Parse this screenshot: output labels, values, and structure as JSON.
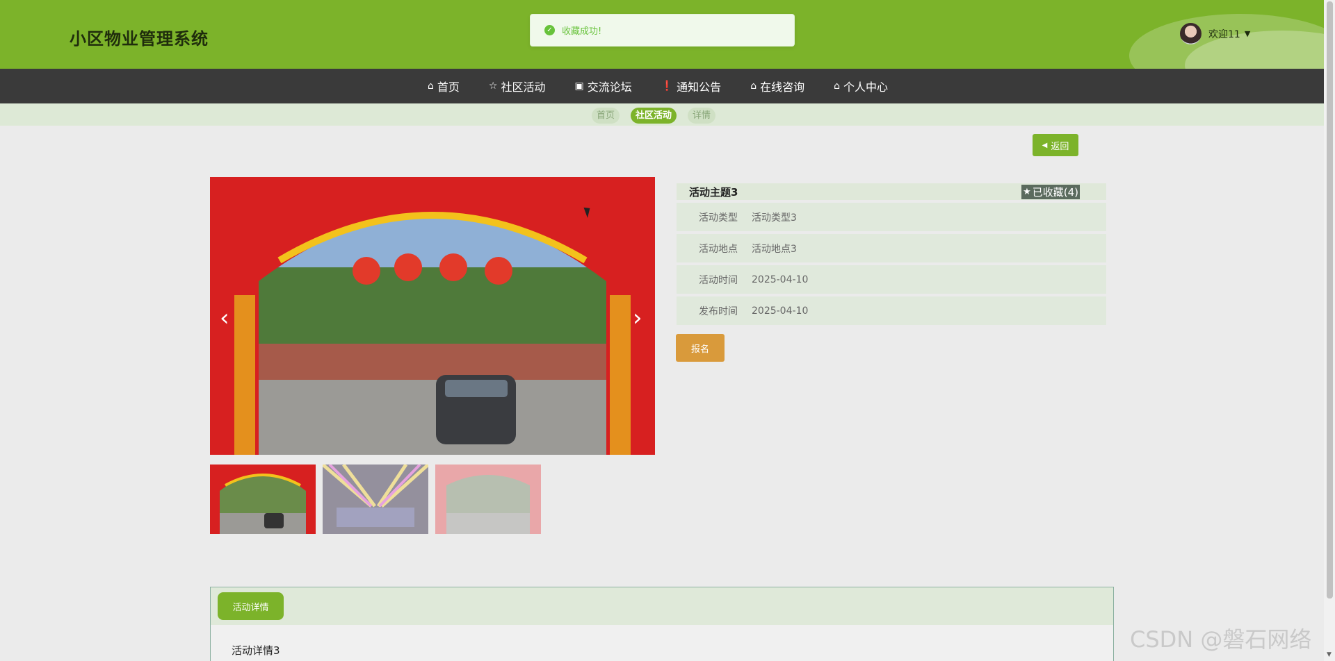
{
  "header": {
    "site_title": "小区物业管理系统",
    "welcome": "欢迎11",
    "caret": "▼"
  },
  "toast": {
    "icon": "✓",
    "message": "收藏成功!"
  },
  "nav": {
    "items": [
      {
        "icon": "⌂",
        "label": "首页"
      },
      {
        "icon": "☆",
        "label": "社区活动"
      },
      {
        "icon": "▣",
        "label": "交流论坛"
      },
      {
        "icon": "❗",
        "label": "通知公告"
      },
      {
        "icon": "⌂",
        "label": "在线咨询"
      },
      {
        "icon": "⌂",
        "label": "个人中心"
      }
    ]
  },
  "breadcrumb": [
    "首页",
    "社区活动",
    "详情"
  ],
  "back_button": {
    "icon": "◀",
    "label": "返回"
  },
  "carousel": {
    "prev": "‹",
    "next": "›"
  },
  "activity": {
    "title": "活动主题3",
    "favorite": {
      "icon": "★",
      "label": "已收藏(4)"
    },
    "fields": [
      {
        "key": "活动类型",
        "value": "活动类型3"
      },
      {
        "key": "活动地点",
        "value": "活动地点3"
      },
      {
        "key": "活动时间",
        "value": "2025-04-10"
      },
      {
        "key": "发布时间",
        "value": "2025-04-10"
      }
    ],
    "signup_label": "报名"
  },
  "detail": {
    "tab_label": "活动详情",
    "content": "活动详情3"
  },
  "watermark": "CSDN @磐石网络",
  "colors": {
    "brand_green": "#7cb32a",
    "nav_dark": "#3a3a3a",
    "signup_orange": "#d99a3b",
    "success": "#67c23a"
  }
}
